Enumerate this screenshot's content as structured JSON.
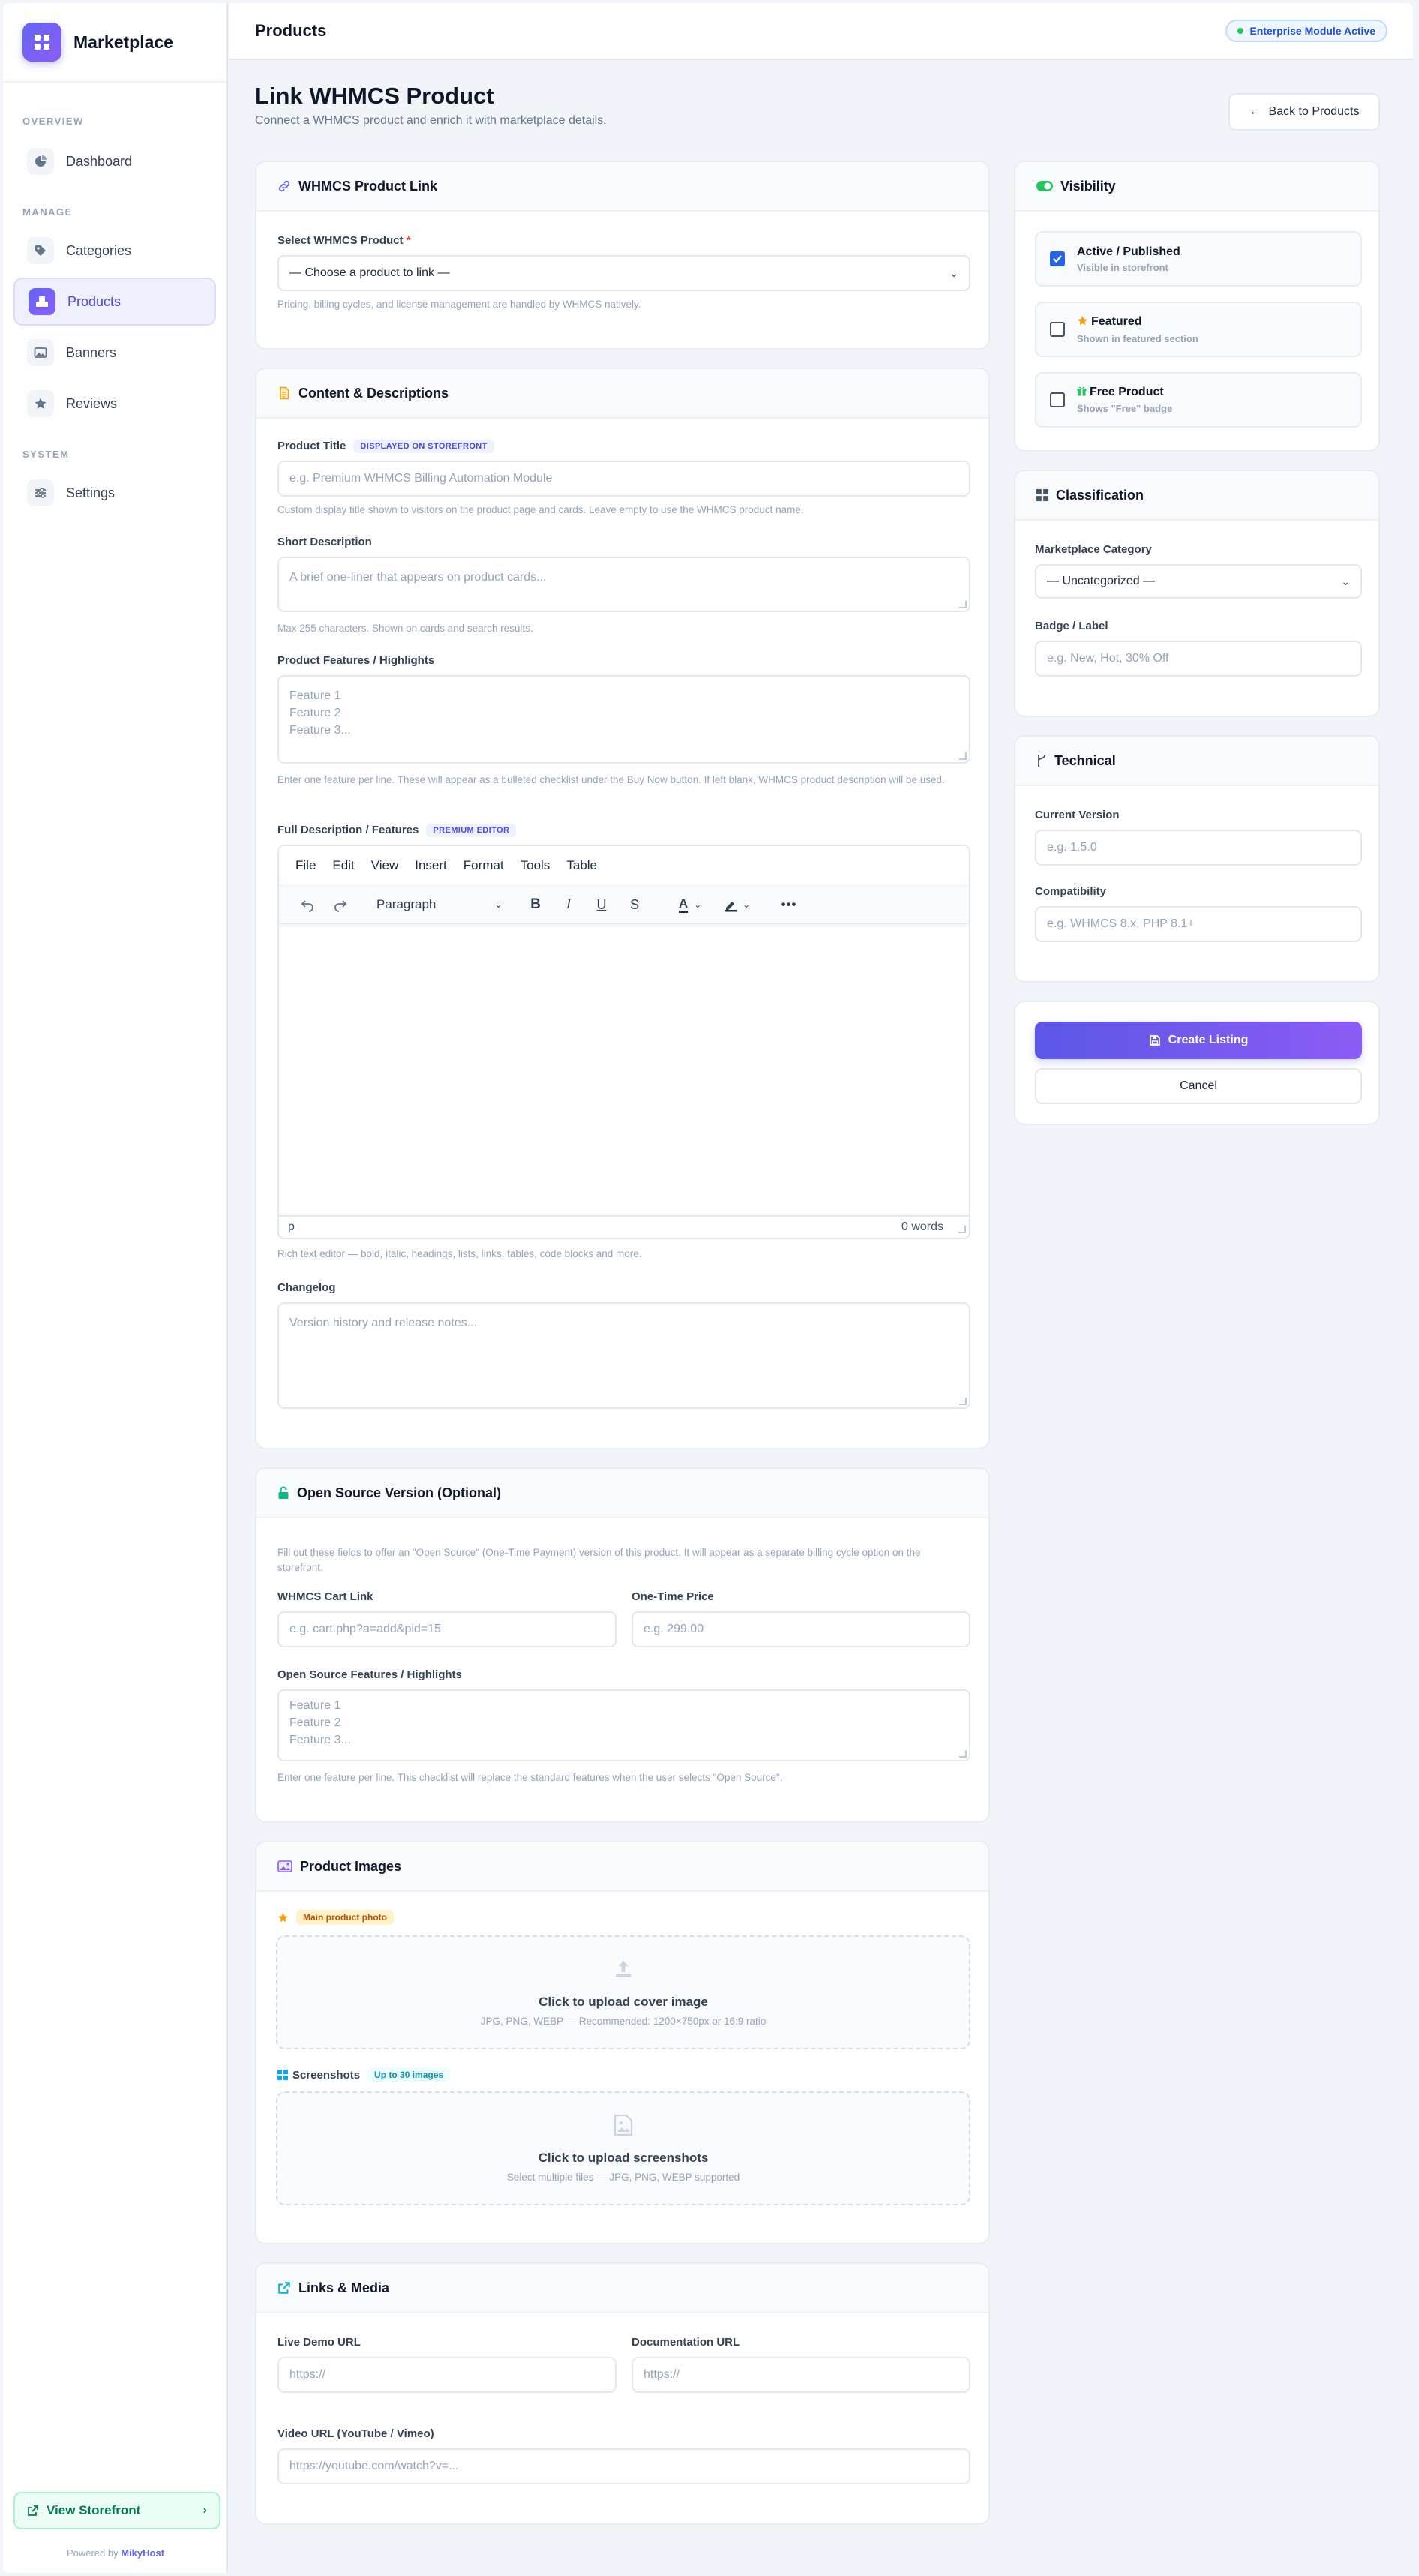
{
  "sidebar": {
    "brand": "Marketplace",
    "sections": {
      "overview": "OVERVIEW",
      "manage": "MANAGE",
      "system": "SYSTEM"
    },
    "items": {
      "dashboard": "Dashboard",
      "categories": "Categories",
      "products": "Products",
      "banners": "Banners",
      "reviews": "Reviews",
      "settings": "Settings"
    },
    "active_item": "Products",
    "storefront": "View Storefront",
    "powered_prefix": "Powered by",
    "powered_brand": "MikyHost"
  },
  "topbar": {
    "title": "Products",
    "badge": "Enterprise Module Active"
  },
  "page": {
    "title": "Link WHMCS Product",
    "subtitle": "Connect a WHMCS product and enrich it with marketplace details.",
    "back": "Back to Products"
  },
  "link_card": {
    "title": "WHMCS Product Link",
    "select_label": "Select WHMCS Product",
    "required": "*",
    "select_value": "— Choose a product to link —",
    "hint": "Pricing, billing cycles, and license management are handled by WHMCS natively."
  },
  "content_card": {
    "title": "Content & Descriptions",
    "product_title_label": "Product Title",
    "product_title_tag": "DISPLAYED ON STOREFRONT",
    "product_title_placeholder": "e.g. Premium WHMCS Billing Automation Module",
    "product_title_hint": "Custom display title shown to visitors on the product page and cards. Leave empty to use the WHMCS product name.",
    "short_label": "Short Description",
    "short_placeholder": "A brief one-liner that appears on product cards...",
    "short_hint": "Max 255 characters. Shown on cards and search results.",
    "features_label": "Product Features / Highlights",
    "features_placeholder": "Feature 1\nFeature 2\nFeature 3...",
    "features_hint": "Enter one feature per line. These will appear as a bulleted checklist under the Buy Now button. If left blank, WHMCS product description will be used.",
    "full_label": "Full Description / Features",
    "full_tag": "PREMIUM EDITOR",
    "editor_menu": [
      "File",
      "Edit",
      "View",
      "Insert",
      "Format",
      "Tools",
      "Table"
    ],
    "editor_block": "Paragraph",
    "editor_path": "p",
    "editor_words": "0 words",
    "editor_hint": "Rich text editor — bold, italic, headings, lists, links, tables, code blocks and more.",
    "changelog_label": "Changelog",
    "changelog_placeholder": "Version history and release notes..."
  },
  "oss_card": {
    "title": "Open Source Version (Optional)",
    "intro": "Fill out these fields to offer an \"Open Source\" (One-Time Payment) version of this product. It will appear as a separate billing cycle option on the storefront.",
    "cart_label": "WHMCS Cart Link",
    "cart_placeholder": "e.g. cart.php?a=add&pid=15",
    "price_label": "One-Time Price",
    "price_placeholder": "e.g. 299.00",
    "features_label": "Open Source Features / Highlights",
    "features_placeholder": "Feature 1\nFeature 2\nFeature 3...",
    "features_hint": "Enter one feature per line. This checklist will replace the standard features when the user selects \"Open Source\"."
  },
  "images_card": {
    "title": "Product Images",
    "main_tag": "Main product photo",
    "cover_title": "Click to upload cover image",
    "cover_sub": "JPG, PNG, WEBP — Recommended: 1200×750px or 16:9 ratio",
    "screens_label": "Screenshots",
    "screens_tag": "Up to 30 images",
    "screens_title": "Click to upload screenshots",
    "screens_sub": "Select multiple files — JPG, PNG, WEBP supported"
  },
  "links_card": {
    "title": "Links & Media",
    "demo_label": "Live Demo URL",
    "demo_placeholder": "https://",
    "docs_label": "Documentation URL",
    "docs_placeholder": "https://",
    "video_label": "Video URL (YouTube / Vimeo)",
    "video_placeholder": "https://youtube.com/watch?v=..."
  },
  "visibility_card": {
    "title": "Visibility",
    "options": [
      {
        "title": "Active / Published",
        "sub": "Visible in storefront",
        "checked": true
      },
      {
        "title": "Featured",
        "sub": "Shown in featured section",
        "checked": false
      },
      {
        "title": "Free Product",
        "sub": "Shows \"Free\" badge",
        "checked": false
      }
    ]
  },
  "classification_card": {
    "title": "Classification",
    "category_label": "Marketplace Category",
    "category_value": "— Uncategorized —",
    "badge_label": "Badge / Label",
    "badge_placeholder": "e.g. New, Hot, 30% Off"
  },
  "technical_card": {
    "title": "Technical",
    "version_label": "Current Version",
    "version_placeholder": "e.g. 1.5.0",
    "compat_label": "Compatibility",
    "compat_placeholder": "e.g. WHMCS 8.x, PHP 8.1+"
  },
  "actions": {
    "create": "Create Listing",
    "cancel": "Cancel"
  },
  "colors": {
    "accent": "#6366f1",
    "accent2": "#8b5cf6",
    "success": "#22c55e",
    "info": "#1d4ed8"
  }
}
